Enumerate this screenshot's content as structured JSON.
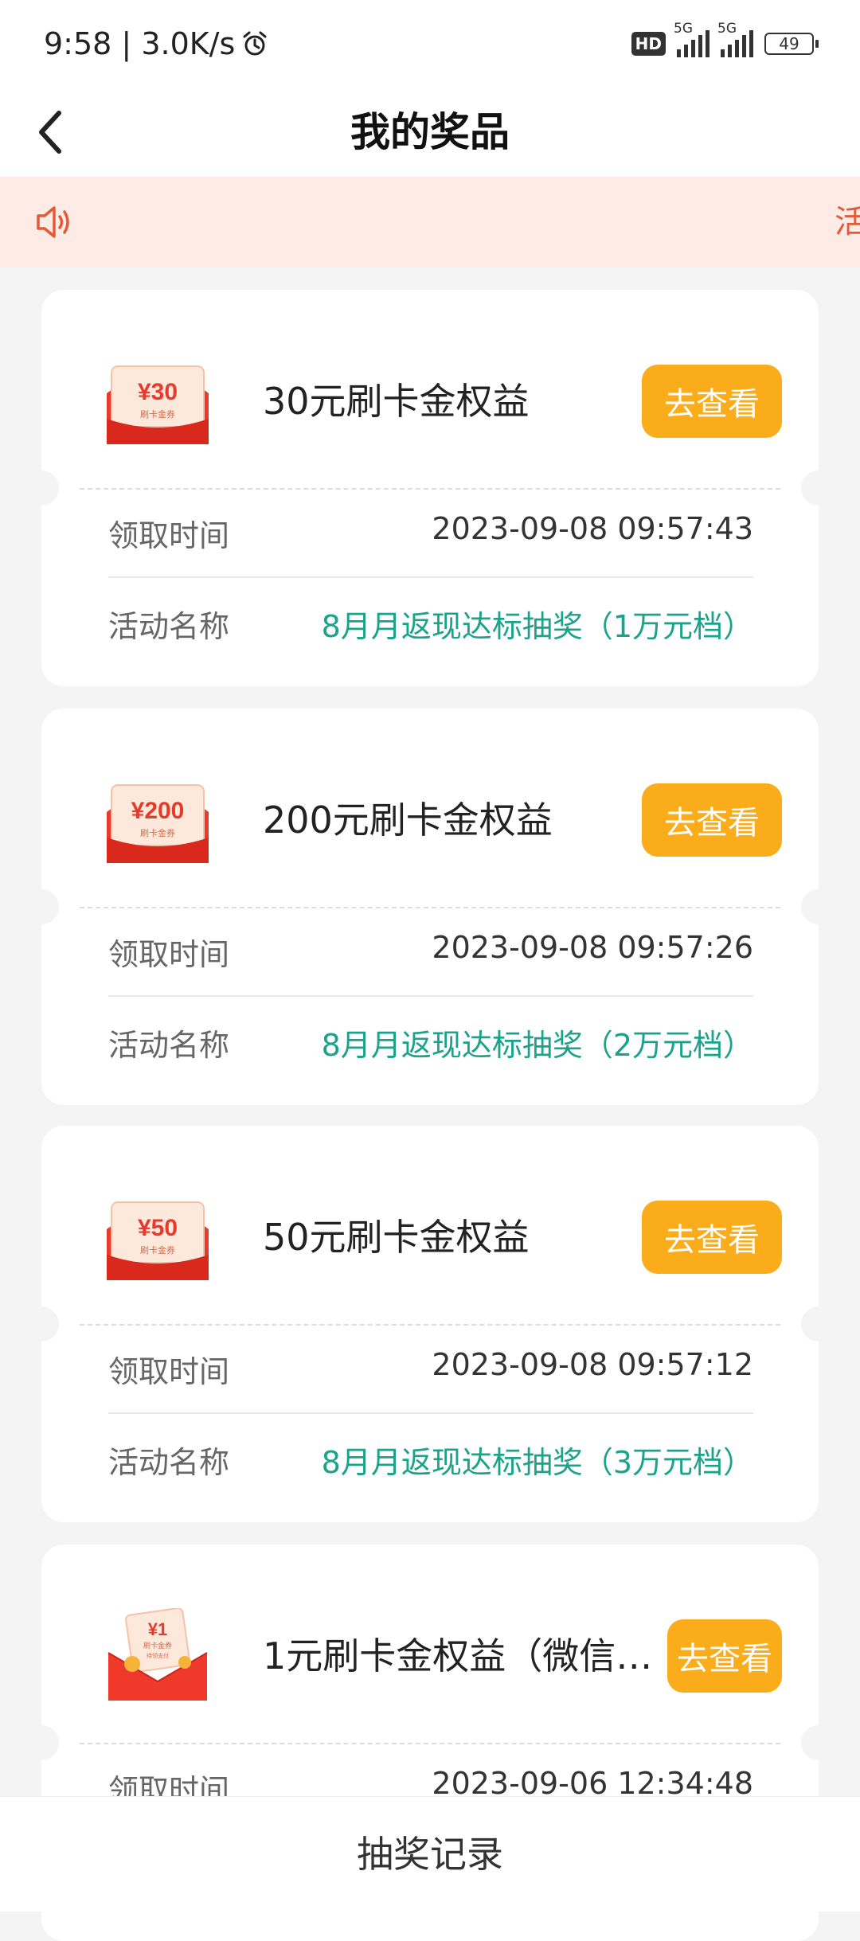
{
  "status_bar": {
    "time": "9:58",
    "speed": "3.0K/s",
    "hd_label": "HD",
    "network_1": "5G",
    "network_2": "5G",
    "battery": "49"
  },
  "header": {
    "title": "我的奖品"
  },
  "notice": {
    "text": "活"
  },
  "labels": {
    "time_label": "领取时间",
    "activity_label": "活动名称",
    "view_button": "去查看"
  },
  "prizes": [
    {
      "amount": "30",
      "coupon_sub": "刷卡金券",
      "name": "30元刷卡金权益",
      "claim_time": "2023-09-08 09:57:43",
      "activity": "8月月返现达标抽奖（1万元档）"
    },
    {
      "amount": "200",
      "coupon_sub": "刷卡金券",
      "name": "200元刷卡金权益",
      "claim_time": "2023-09-08 09:57:26",
      "activity": "8月月返现达标抽奖（2万元档）"
    },
    {
      "amount": "50",
      "coupon_sub": "刷卡金券",
      "name": "50元刷卡金权益",
      "claim_time": "2023-09-08 09:57:12",
      "activity": "8月月返现达标抽奖（3万元档）"
    },
    {
      "amount": "1",
      "coupon_sub": "刷卡金券",
      "coupon_sub2": "待领支付",
      "name": "1元刷卡金权益（微信…",
      "claim_time": "2023-09-06 12:34:48"
    }
  ],
  "bottom": {
    "label": "抽奖记录"
  },
  "colors": {
    "accent": "#fbac1a",
    "green": "#1aa38a",
    "notice_bg": "#fdebe6",
    "red": "#e53a2c"
  }
}
